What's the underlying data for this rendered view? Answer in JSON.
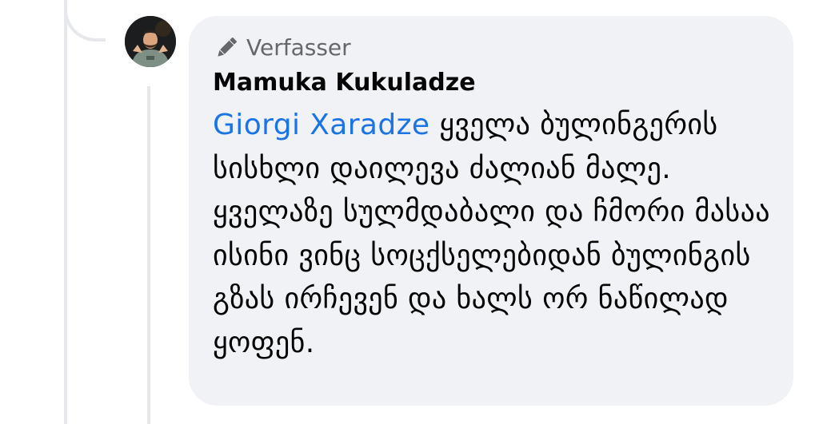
{
  "comment": {
    "badge": {
      "icon": "pencil-icon",
      "label": "Verfasser"
    },
    "author": "Mamuka Kukuladze",
    "mention": "Giorgi Xaradze",
    "text": " ყველა ბულინგერის სისხლი დაილევა ძალიან მალე. ყველაზე სულმდაბალი და ჩმორი მასაა ისინი ვინც სოცქსელებიდან ბულინგის გზას ირჩევენ და ხალს ორ ნაწილად ყოფენ."
  },
  "colors": {
    "bubble_background": "#f0f2f5",
    "mention_link": "#1b74e4",
    "secondary_text": "#65676b",
    "primary_text": "#050505",
    "thread_line": "#e6e8ec"
  }
}
